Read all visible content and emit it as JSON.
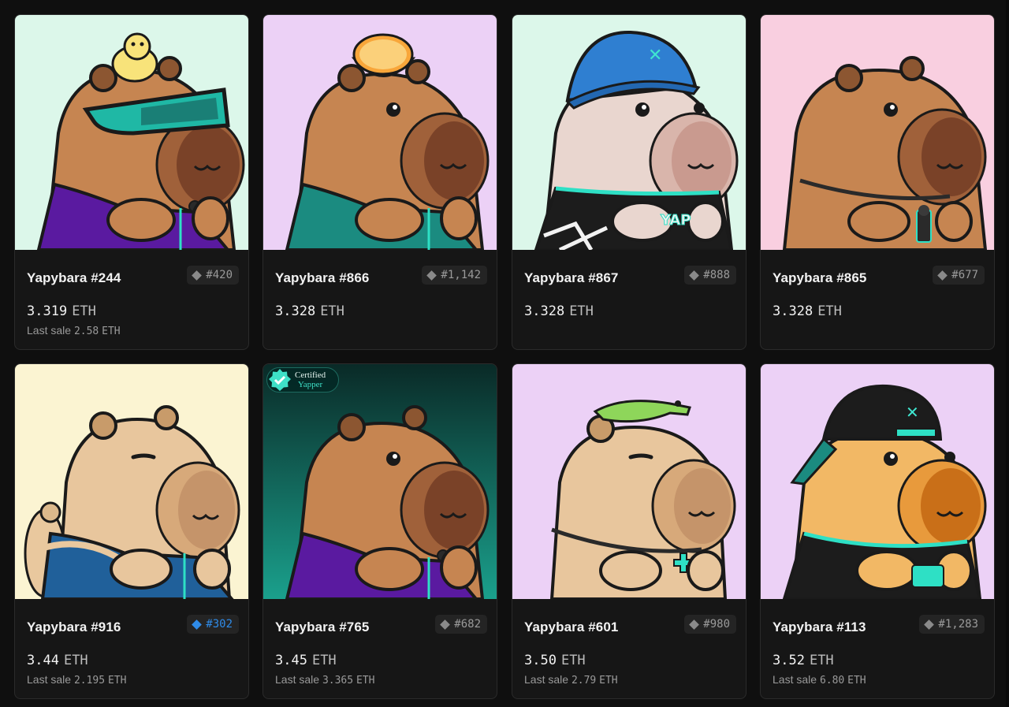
{
  "cards": [
    {
      "name": "Yapybara #244",
      "rank": "#420",
      "rank_style": "gray",
      "price": "3.319",
      "price_unit": "ETH",
      "last_sale_label": "Last sale",
      "last_sale_value": "2.58",
      "last_sale_unit": "ETH",
      "bg": "#dcf7ea",
      "fur": "#c68551",
      "outfit": "purple-jacket",
      "accessory": "duck+goggles"
    },
    {
      "name": "Yapybara #866",
      "rank": "#1,142",
      "rank_style": "gray",
      "price": "3.328",
      "price_unit": "ETH",
      "last_sale_label": "",
      "last_sale_value": "",
      "last_sale_unit": "",
      "bg": "#ecd1f6",
      "fur": "#c68551",
      "outfit": "teal-jacket",
      "accessory": "orange"
    },
    {
      "name": "Yapybara #867",
      "rank": "#888",
      "rank_style": "gray",
      "price": "3.328",
      "price_unit": "ETH",
      "last_sale_label": "",
      "last_sale_value": "",
      "last_sale_unit": "",
      "bg": "#dcf7ea",
      "fur": "#e9d6cf",
      "outfit": "black-jersey",
      "accessory": "blue-bucket-hat"
    },
    {
      "name": "Yapybara #865",
      "rank": "#677",
      "rank_style": "gray",
      "price": "3.328",
      "price_unit": "ETH",
      "last_sale_label": "",
      "last_sale_value": "",
      "last_sale_unit": "",
      "bg": "#f9cfe0",
      "fur": "#c68551",
      "outfit": "none",
      "accessory": "necklace"
    },
    {
      "name": "Yapybara #916",
      "rank": "#302",
      "rank_style": "blue",
      "price": "3.44",
      "price_unit": "ETH",
      "last_sale_label": "Last sale",
      "last_sale_value": "2.195",
      "last_sale_unit": "ETH",
      "bg": "#fbf4d2",
      "fur": "#e8c69d",
      "outfit": "blue-jacket",
      "accessory": "turtle"
    },
    {
      "name": "Yapybara #765",
      "rank": "#682",
      "rank_style": "gray",
      "price": "3.45",
      "price_unit": "ETH",
      "last_sale_label": "Last sale",
      "last_sale_value": "3.365",
      "last_sale_unit": "ETH",
      "bg": "gradient-teal",
      "fur": "#c68551",
      "outfit": "purple-jacket",
      "accessory": "certified-badge",
      "badge_line1": "Certified",
      "badge_line2": "Yapper"
    },
    {
      "name": "Yapybara #601",
      "rank": "#980",
      "rank_style": "gray",
      "price": "3.50",
      "price_unit": "ETH",
      "last_sale_label": "Last sale",
      "last_sale_value": "2.79",
      "last_sale_unit": "ETH",
      "bg": "#ecd1f6",
      "fur": "#e8c69d",
      "outfit": "none",
      "accessory": "crocodile+necklace"
    },
    {
      "name": "Yapybara #113",
      "rank": "#1,283",
      "rank_style": "gray",
      "price": "3.52",
      "price_unit": "ETH",
      "last_sale_label": "Last sale",
      "last_sale_value": "6.80",
      "last_sale_unit": "ETH",
      "bg": "#ecd1f6",
      "fur": "#f2b865",
      "outfit": "black-tee",
      "accessory": "black-cap"
    }
  ]
}
